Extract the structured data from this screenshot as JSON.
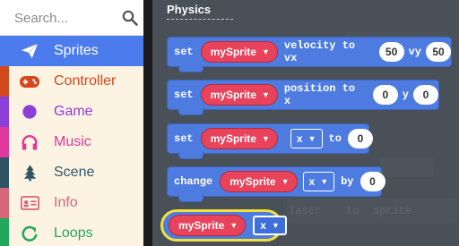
{
  "search": {
    "placeholder": "Search..."
  },
  "categories": [
    {
      "label": "Sprites",
      "color": "#4b7bec",
      "text": "#ffffff",
      "stripe": "#4b7bec",
      "bg": "#4b7bec",
      "icon": "paper-plane-icon",
      "selected": true
    },
    {
      "label": "Controller",
      "color": "#d2491f",
      "text": "#d2491f",
      "stripe": "#d2491f",
      "bg": "#fbe6c8",
      "icon": "gamepad-icon"
    },
    {
      "label": "Game",
      "color": "#8c3fd6",
      "text": "#8c3fd6",
      "stripe": "#8c3fd6",
      "bg": "#fbe6c8",
      "icon": "circle-icon"
    },
    {
      "label": "Music",
      "color": "#e0389c",
      "text": "#e0389c",
      "stripe": "#e0389c",
      "bg": "#fbe6c8",
      "icon": "headphones-icon"
    },
    {
      "label": "Scene",
      "color": "#2f5565",
      "text": "#2f5565",
      "stripe": "#2f5565",
      "bg": "#fbe6c8",
      "icon": "tree-icon"
    },
    {
      "label": "Info",
      "color": "#d4667a",
      "text": "#d4667a",
      "stripe": "#d4667a",
      "bg": "#fbe6c8",
      "icon": "id-card-icon"
    },
    {
      "label": "Loops",
      "color": "#21a85a",
      "text": "#21a85a",
      "stripe": "#21a85a",
      "bg": "#fbe6c8",
      "icon": "loop-icon"
    }
  ],
  "flyout": {
    "section_title": "Physics",
    "sprite_var": "mySprite",
    "blocks": {
      "velocity": {
        "kw": "set",
        "mid": "velocity to vx",
        "vx": "50",
        "mid2": "vy",
        "vy": "50"
      },
      "position": {
        "kw": "set",
        "mid": "position to x",
        "x": "0",
        "mid2": "y",
        "y": "0"
      },
      "set_prop": {
        "kw": "set",
        "prop": "x",
        "mid": "to",
        "value": "0"
      },
      "change_prop": {
        "kw": "change",
        "prop": "x",
        "mid": "by",
        "value": "0"
      },
      "reporter": {
        "prop": "x"
      }
    }
  },
  "background": {
    "ghost1": "laser",
    "ghost2": "to",
    "ghost3": "sprite"
  }
}
